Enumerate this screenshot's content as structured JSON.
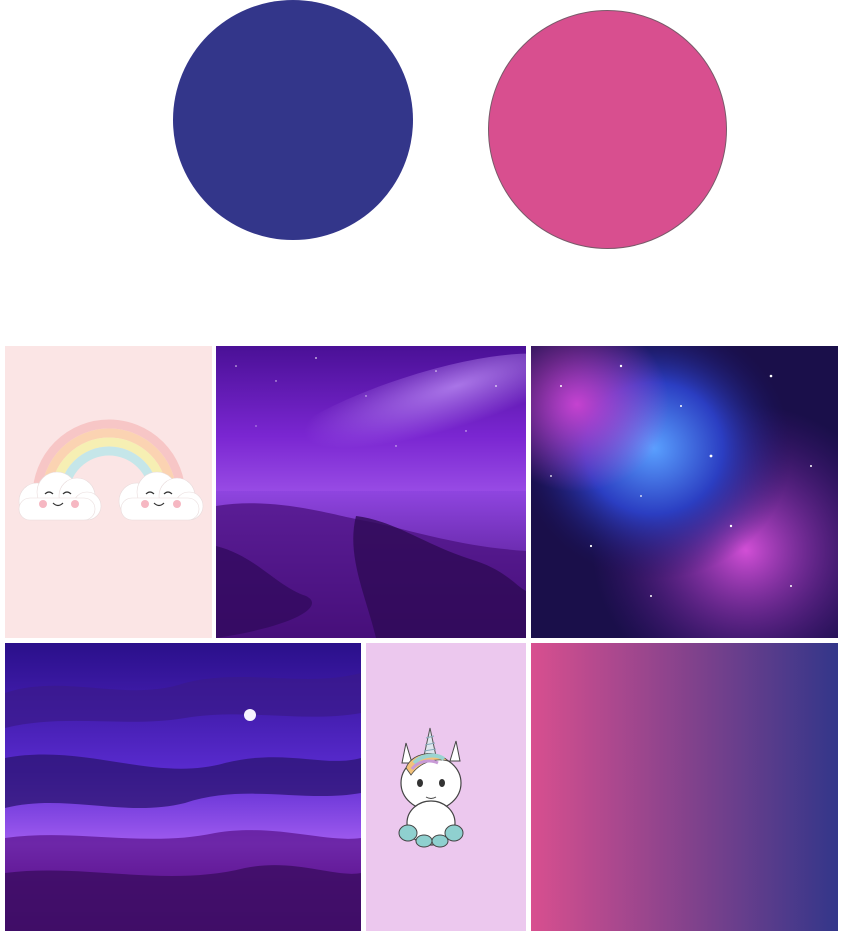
{
  "palette": {
    "swatches": [
      {
        "name": "navy-indigo",
        "color": "#33368a"
      },
      {
        "name": "hot-pink",
        "color": "#d84f8f"
      }
    ]
  },
  "moodboard": {
    "tiles": [
      {
        "name": "rainbow-clouds",
        "background": "#fbe5e5"
      },
      {
        "name": "purple-seascape-night"
      },
      {
        "name": "purple-blue-nebula"
      },
      {
        "name": "purple-cloudy-sky-moon"
      },
      {
        "name": "cute-unicorn",
        "background": "#ecc8ee"
      },
      {
        "name": "pink-to-navy-gradient",
        "gradient_from": "#d84f8f",
        "gradient_to": "#33368a"
      }
    ]
  }
}
